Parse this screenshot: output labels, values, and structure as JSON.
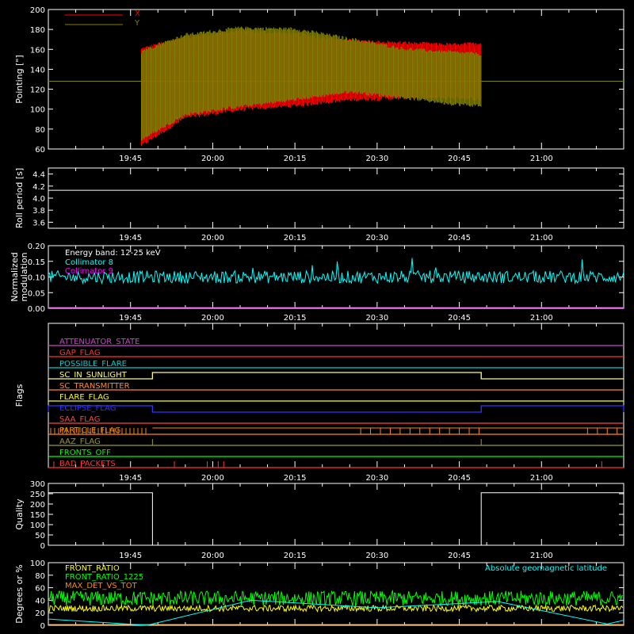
{
  "chart_data": [
    {
      "id": "pointing",
      "type": "line",
      "ylabel": "Pointing [\"]",
      "ylim": [
        60,
        200
      ],
      "yticks": [
        "60",
        "80",
        "100",
        "120",
        "140",
        "160",
        "180",
        "200"
      ],
      "xlim": [
        "19:30",
        "21:15"
      ],
      "xticks": [
        "19:45",
        "20:00",
        "20:15",
        "20:30",
        "20:45",
        "21:00"
      ],
      "legend": "top-left",
      "baseline": 128,
      "series": [
        {
          "name": "X",
          "color": "#ff0000",
          "x": [
            "19:47",
            "19:55",
            "20:05",
            "20:15",
            "20:25",
            "20:35",
            "20:45",
            "20:49"
          ],
          "upper": [
            160,
            172,
            178,
            175,
            168,
            166,
            164,
            166
          ],
          "lower": [
            64,
            92,
            100,
            104,
            110,
            112,
            112,
            110
          ]
        },
        {
          "name": "Y",
          "color": "#808000",
          "x": [
            "19:47",
            "19:55",
            "20:05",
            "20:15",
            "20:25",
            "20:35",
            "20:45",
            "20:49"
          ],
          "upper": [
            158,
            174,
            181,
            180,
            170,
            160,
            156,
            155
          ],
          "lower": [
            70,
            95,
            103,
            110,
            118,
            112,
            105,
            104
          ]
        }
      ]
    },
    {
      "id": "roll",
      "type": "line",
      "ylabel": "Roll period [s]",
      "ylim": [
        3.5,
        4.5
      ],
      "yticks": [
        "3.6",
        "3.8",
        "4.0",
        "4.2",
        "4.4"
      ],
      "xticks": [
        "19:45",
        "20:00",
        "20:15",
        "20:30",
        "20:45",
        "21:00"
      ],
      "series": [
        {
          "name": "",
          "color": "#ffffff",
          "x": [
            "19:30",
            "21:15"
          ],
          "values": [
            4.13,
            4.13
          ]
        }
      ]
    },
    {
      "id": "modulation",
      "type": "line",
      "ylabel": "Normalized modulation",
      "ylim": [
        0.0,
        0.2
      ],
      "yticks": [
        "0.00",
        "0.05",
        "0.10",
        "0.15",
        "0.20"
      ],
      "xticks": [
        "19:45",
        "20:00",
        "20:15",
        "20:30",
        "20:45",
        "21:00"
      ],
      "annotation": "Energy band: 12-25 keV",
      "legend": "top-left",
      "series": [
        {
          "name": "Collimator 8",
          "color": "#00ffff",
          "level": 0.1,
          "spread": 0.025
        },
        {
          "name": "Collimator 9",
          "color": "#ff00ff",
          "level": 0.0
        }
      ]
    },
    {
      "id": "flags",
      "type": "line",
      "ylabel": "Flags",
      "xticks": [
        "19:45",
        "20:00",
        "20:15",
        "20:30",
        "20:45",
        "21:00"
      ],
      "flags": [
        {
          "name": "ATTENUATOR_STATE",
          "color": "#cc44cc"
        },
        {
          "name": "GAP_FLAG",
          "color": "#ff3333"
        },
        {
          "name": "POSSIBLE_FLARE",
          "color": "#00cccc"
        },
        {
          "name": "SC_IN_SUNLIGHT",
          "color": "#ffff66",
          "high": [
            [
              "19:49",
              "20:49"
            ]
          ]
        },
        {
          "name": "SC_TRANSMITTER",
          "color": "#ff8833"
        },
        {
          "name": "FLARE_FLAG",
          "color": "#ffff00"
        },
        {
          "name": "ECLIPSE_FLAG",
          "color": "#3333ff",
          "high": [
            [
              "19:30",
              "19:49"
            ],
            [
              "20:49",
              "21:15"
            ]
          ]
        },
        {
          "name": "SAA_FLAG",
          "color": "#ff4444"
        },
        {
          "name": "PARTICLE_FLAG",
          "color": "#ff8800"
        },
        {
          "name": "AAZ_FLAG",
          "color": "#999933"
        },
        {
          "name": "FRONTS_OFF",
          "color": "#00ff00"
        },
        {
          "name": "BAD_PACKETS",
          "color": "#ff3333"
        }
      ]
    },
    {
      "id": "quality",
      "type": "line",
      "ylabel": "Quality",
      "ylim": [
        0,
        300
      ],
      "yticks": [
        "0",
        "50",
        "100",
        "150",
        "200",
        "250",
        "300"
      ],
      "xticks": [
        "19:45",
        "20:00",
        "20:15",
        "20:30",
        "20:45",
        "21:00"
      ],
      "series": [
        {
          "name": "",
          "color": "#ffffff",
          "x": [
            "19:30",
            "19:49",
            "19:49",
            "20:49",
            "20:49",
            "21:15"
          ],
          "values": [
            255,
            255,
            0,
            0,
            255,
            255
          ]
        }
      ]
    },
    {
      "id": "ratios",
      "type": "line",
      "ylabel": "Degrees or %",
      "ylim": [
        0,
        100
      ],
      "yticks": [
        "0",
        "20",
        "40",
        "60",
        "80",
        "100"
      ],
      "xticks": [
        "19:45",
        "20:00",
        "20:15",
        "20:30",
        "20:45",
        "21:00"
      ],
      "legend": "top-left",
      "series": [
        {
          "name": "FRONT_RATIO",
          "color": "#ffff00",
          "level": 27,
          "spread": 5
        },
        {
          "name": "FRONT_RATIO_1225",
          "color": "#00ff00",
          "level": 43,
          "spread": 12
        },
        {
          "name": "MAX_DET_VS_TOT",
          "color": "#ff8800",
          "level": 0
        },
        {
          "name": "Absolute geomagnetic latitude",
          "color": "#00ffff",
          "x": [
            "19:30",
            "19:48",
            "20:07",
            "20:30",
            "20:52",
            "21:12",
            "21:15"
          ],
          "values": [
            10,
            0,
            40,
            28,
            38,
            2,
            8
          ]
        }
      ]
    }
  ]
}
